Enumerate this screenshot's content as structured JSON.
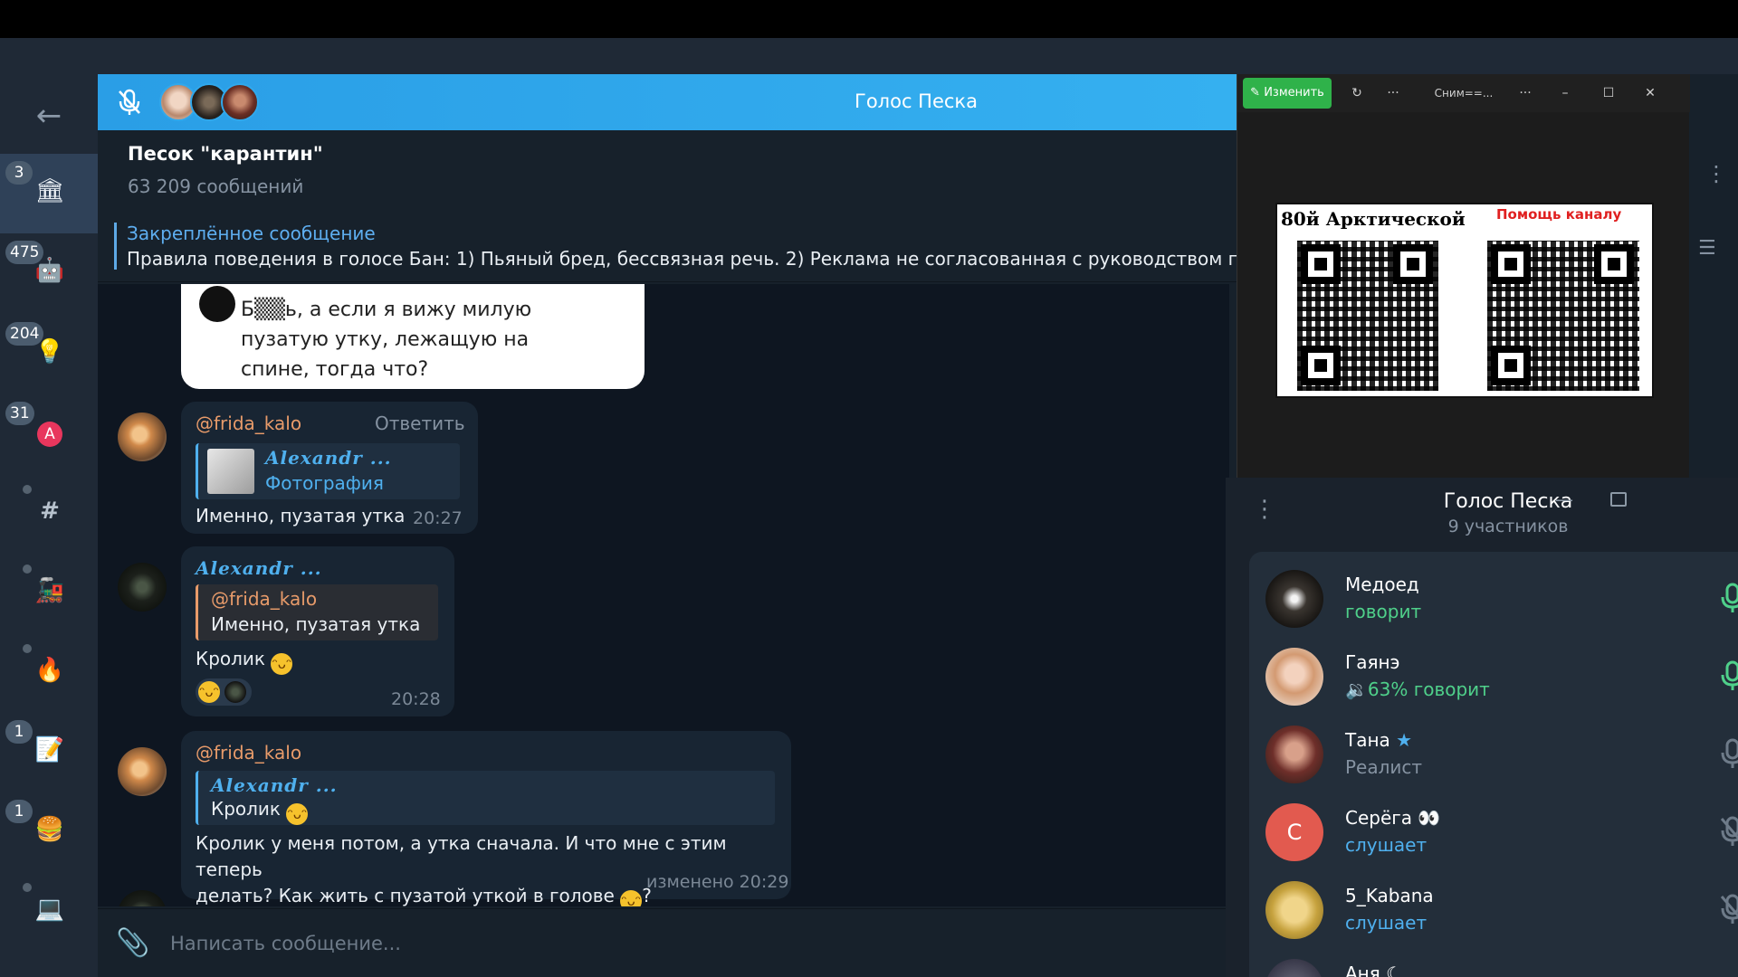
{
  "voice_bar": {
    "title": "Голос Песка"
  },
  "chat": {
    "name": "Песок \"карантин\"",
    "message_count": "63 209 сообщений",
    "pinned_title": "Закреплённое сообщение",
    "pinned_text": "Правила поведения в голосе  Бан: 1) Пьяный бред, бессвязная речь. 2) Реклама не согласованная с руководством пред"
  },
  "sidebar": {
    "folders": [
      {
        "badge": "3",
        "icon": "bank-icon"
      },
      {
        "badge": "475",
        "icon": "robot-icon"
      },
      {
        "badge": "204",
        "icon": "lightbulb-icon"
      },
      {
        "badge": "31",
        "icon": "letter-a-icon"
      },
      {
        "badge": "",
        "icon": "hashtag-icon"
      },
      {
        "badge": "",
        "icon": "train-icon"
      },
      {
        "badge": "",
        "icon": "fire-icon"
      },
      {
        "badge": "1",
        "icon": "memo-icon"
      },
      {
        "badge": "1",
        "icon": "burger-icon"
      },
      {
        "badge": "",
        "icon": "laptop-icon"
      }
    ]
  },
  "messages": {
    "m1": {
      "text": "Б▒▒ь, а если я вижу милую пузатую утку, лежащую на спине, тогда что?"
    },
    "m2": {
      "author": "@frida_kalo",
      "reply_label": "Ответить",
      "quote_author": "𝑨𝒍𝒆𝒙𝒂𝒏𝒅𝒓 ...",
      "quote_text": "Фотография",
      "text": "Именно, пузатая утка",
      "time": "20:27"
    },
    "m3": {
      "author": "𝑨𝒍𝒆𝒙𝒂𝒏𝒅𝒓 ...",
      "quote_author": "@frida_kalo",
      "quote_text": "Именно, пузатая утка",
      "text": "Кролик",
      "time": "20:28"
    },
    "m4": {
      "author": "@frida_kalo",
      "quote_author": "𝑨𝒍𝒆𝒙𝒂𝒏𝒅𝒓 ...",
      "quote_text": "Кролик",
      "text_line1": "Кролик у меня потом, а утка сначала. И что мне с этим теперь",
      "text_line2": "делать? Как жить с пузатой уткой в голове",
      "text_end": "?",
      "time": "изменено 20:29"
    }
  },
  "composer": {
    "placeholder": "Написать сообщение..."
  },
  "viewer": {
    "edit_label": "Изменить",
    "file_label": "Сним==...",
    "caption_left": "80й Арктической",
    "caption_right": "Помощь каналу"
  },
  "voice_panel": {
    "title": "Голос Песка",
    "subtitle": "9 участников",
    "participants": [
      {
        "name": "Медоед",
        "status": "говорит",
        "mic": "active",
        "color": "#4fd08a"
      },
      {
        "name": "Гаянэ",
        "status": "63% говорит",
        "mic": "active",
        "color": "#4fd08a"
      },
      {
        "name": "Тана",
        "status": "Реалист",
        "mic": "on",
        "color": "#8592a1"
      },
      {
        "name": "Серёга",
        "status": "слушает",
        "mic": "muted",
        "color": "#4fb0ee",
        "initial": "С"
      },
      {
        "name": "5_Kabana",
        "status": "слушает",
        "mic": "muted",
        "color": "#4fb0ee"
      },
      {
        "name": "Аня",
        "status": "",
        "mic": "muted",
        "color": "#4fb0ee"
      }
    ]
  }
}
